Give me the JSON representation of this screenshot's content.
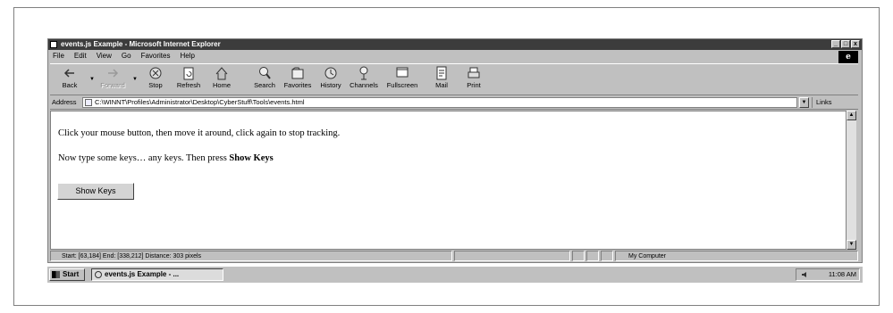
{
  "window": {
    "title": "events.js Example - Microsoft Internet Explorer",
    "controls": {
      "minimize": "_",
      "maximize": "□",
      "close": "x"
    }
  },
  "menu": [
    "File",
    "Edit",
    "View",
    "Go",
    "Favorites",
    "Help"
  ],
  "toolbar": {
    "buttons": [
      {
        "label": "Back",
        "icon": "back-arrow-icon",
        "enabled": true
      },
      {
        "label": "Forward",
        "icon": "forward-arrow-icon",
        "enabled": false
      },
      {
        "label": "Stop",
        "icon": "stop-icon",
        "enabled": true
      },
      {
        "label": "Refresh",
        "icon": "refresh-icon",
        "enabled": true
      },
      {
        "label": "Home",
        "icon": "home-icon",
        "enabled": true
      },
      {
        "label": "Search",
        "icon": "search-icon",
        "enabled": true
      },
      {
        "label": "Favorites",
        "icon": "favorites-icon",
        "enabled": true
      },
      {
        "label": "History",
        "icon": "history-icon",
        "enabled": true
      },
      {
        "label": "Channels",
        "icon": "channels-icon",
        "enabled": true
      },
      {
        "label": "Fullscreen",
        "icon": "fullscreen-icon",
        "enabled": true
      },
      {
        "label": "Mail",
        "icon": "mail-icon",
        "enabled": true
      },
      {
        "label": "Print",
        "icon": "print-icon",
        "enabled": true
      }
    ]
  },
  "address": {
    "label": "Address",
    "value": "C:\\WINNT\\Profiles\\Administrator\\Desktop\\CyberStuff\\Tools\\events.html",
    "links_label": "Links"
  },
  "content": {
    "line1": "Click your mouse button, then move it around, click again to stop tracking.",
    "line2_prefix": "Now type some keys… any keys. Then press ",
    "line2_bold": "Show Keys",
    "button_label": "Show Keys"
  },
  "status": {
    "text": "Start: [63,184]  End: [338,212]  Distance: 303 pixels",
    "zone": "My Computer"
  },
  "taskbar": {
    "start_label": "Start",
    "task_label": "events.js Example - ...",
    "clock": "11:08 AM"
  }
}
